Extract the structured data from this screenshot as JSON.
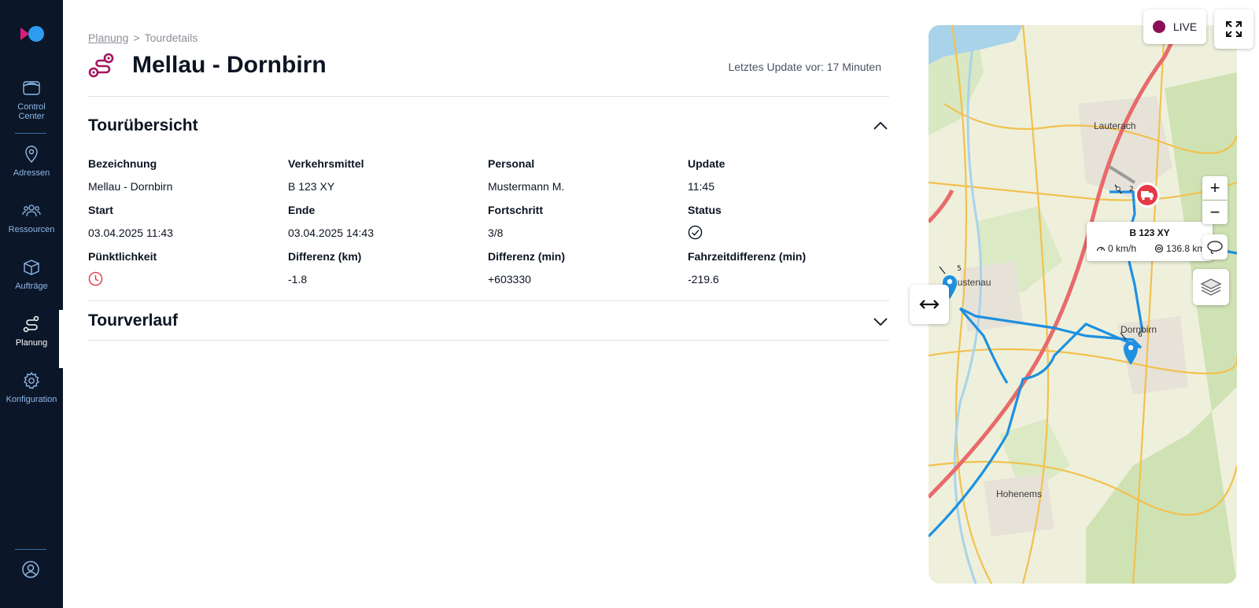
{
  "sidebar": {
    "items": [
      {
        "label": "Control Center",
        "icon": "control-center-icon"
      },
      {
        "label": "Adressen",
        "icon": "location-pin-icon"
      },
      {
        "label": "Ressourcen",
        "icon": "people-icon"
      },
      {
        "label": "Aufträge",
        "icon": "package-icon"
      },
      {
        "label": "Planung",
        "icon": "route-icon",
        "active": true
      },
      {
        "label": "Konfiguration",
        "icon": "gear-icon"
      }
    ],
    "user_icon": "user-circle-icon"
  },
  "breadcrumb": {
    "parent": "Planung",
    "separator": ">",
    "current": "Tourdetails"
  },
  "page": {
    "title": "Mellau - Dornbirn",
    "last_update": "Letztes Update vor: 17 Minuten"
  },
  "overview": {
    "title": "Tourübersicht",
    "labels": {
      "bezeichnung": "Bezeichnung",
      "verkehrsmittel": "Verkehrsmittel",
      "personal": "Personal",
      "update": "Update",
      "start": "Start",
      "ende": "Ende",
      "fortschritt": "Fortschritt",
      "status": "Status",
      "puenktlichkeit": "Pünktlichkeit",
      "diff_km": "Differenz (km)",
      "diff_min": "Differenz (min)",
      "fahrzeit_diff": "Fahrzeitdifferenz (min)"
    },
    "values": {
      "bezeichnung": "Mellau - Dornbirn",
      "verkehrsmittel": "B 123 XY",
      "personal": "Mustermann M.",
      "update": "11:45",
      "start": "03.04.2025 11:43",
      "ende": "03.04.2025 14:43",
      "fortschritt": "3/8",
      "diff_km": "-1.8",
      "diff_min": "+603330",
      "fahrzeit_diff": "-219.6"
    }
  },
  "tourverlauf": {
    "title": "Tourverlauf"
  },
  "map": {
    "live_label": "LIVE",
    "zoom_in": "+",
    "zoom_out": "−",
    "vehicle": {
      "name": "B 123 XY",
      "speed": "0 km/h",
      "distance": "136.8 km"
    },
    "places": [
      "Lauterach",
      "Hohenems",
      "Dornbirn",
      "Lustenau"
    ],
    "markers": [
      "2",
      "5",
      "6"
    ],
    "colors": {
      "route": "#1e90e0",
      "vehicle": "#e53945",
      "highway": "#e86a6a",
      "road": "#f2c14e"
    }
  },
  "colors": {
    "sidebar": "#0b1628",
    "accent": "#a3155f",
    "live_dot": "#8a0f55"
  }
}
